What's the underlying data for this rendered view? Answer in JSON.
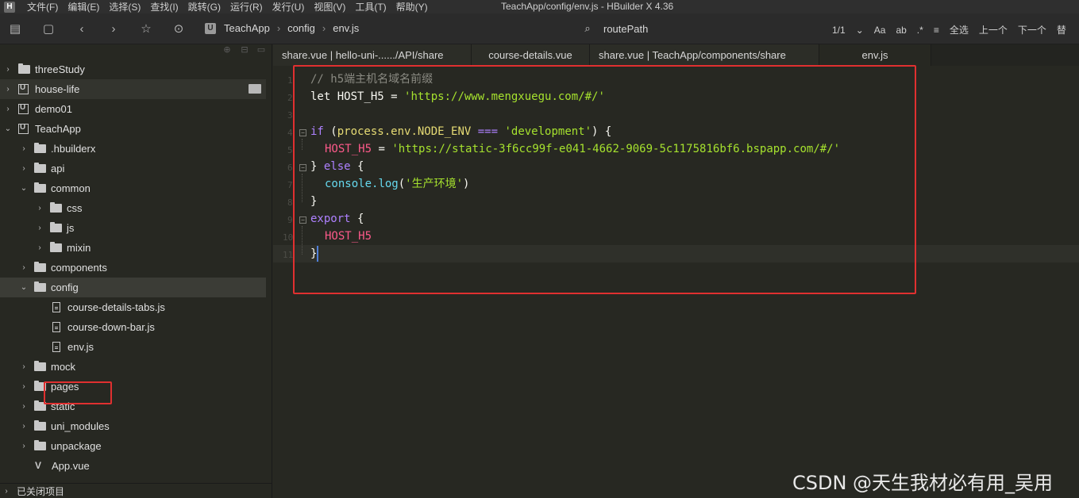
{
  "menubar": {
    "logo": "H",
    "items": [
      "文件(F)",
      "编辑(E)",
      "选择(S)",
      "查找(I)",
      "跳转(G)",
      "运行(R)",
      "发行(U)",
      "视图(V)",
      "工具(T)",
      "帮助(Y)"
    ],
    "title": "TeachApp/config/env.js - HBuilder X 4.36"
  },
  "toolbar": {
    "breadcrumb": [
      "TeachApp",
      "config",
      "env.js"
    ],
    "breadcrumb_badge": "U",
    "search_value": "routePath",
    "find_count": "1/1",
    "find_case": "Aa",
    "find_word": "ab",
    "find_regex": ".*",
    "find_buttons": [
      "全选",
      "上一个",
      "下一个",
      "替"
    ]
  },
  "sidebar": {
    "items": [
      {
        "label": "threeStudy",
        "type": "folder",
        "expanded": false
      },
      {
        "label": "house-life",
        "type": "project",
        "expanded": false
      },
      {
        "label": "demo01",
        "type": "project",
        "expanded": false
      },
      {
        "label": "TeachApp",
        "type": "project",
        "expanded": true
      },
      {
        "label": ".hbuilderx",
        "type": "folder",
        "expanded": false
      },
      {
        "label": "api",
        "type": "folder",
        "expanded": false
      },
      {
        "label": "common",
        "type": "folder",
        "expanded": true
      },
      {
        "label": "css",
        "type": "folder",
        "expanded": false
      },
      {
        "label": "js",
        "type": "folder",
        "expanded": false
      },
      {
        "label": "mixin",
        "type": "folder",
        "expanded": false
      },
      {
        "label": "components",
        "type": "folder",
        "expanded": false
      },
      {
        "label": "config",
        "type": "folder",
        "expanded": true
      },
      {
        "label": "course-details-tabs.js",
        "type": "file"
      },
      {
        "label": "course-down-bar.js",
        "type": "file"
      },
      {
        "label": "env.js",
        "type": "file"
      },
      {
        "label": "mock",
        "type": "folder",
        "expanded": false
      },
      {
        "label": "pages",
        "type": "folder",
        "expanded": false
      },
      {
        "label": "static",
        "type": "folder",
        "expanded": false
      },
      {
        "label": "uni_modules",
        "type": "folder",
        "expanded": false
      },
      {
        "label": "unpackage",
        "type": "folder",
        "expanded": false
      },
      {
        "label": "App.vue",
        "type": "vue"
      }
    ],
    "footer": "已关闭项目"
  },
  "tabs": [
    {
      "label": "share.vue | hello-uni-....../API/share"
    },
    {
      "label": "course-details.vue"
    },
    {
      "label": "share.vue | TeachApp/components/share"
    },
    {
      "label": "env.js",
      "active": true
    }
  ],
  "editor": {
    "line_numbers": [
      "1",
      "2",
      "3",
      "4",
      "5",
      "6",
      "7",
      "8",
      "9",
      "10",
      "11"
    ],
    "line1_comment": "// h5端主机名域名前缀",
    "line2_let": "let",
    "line2_var": " HOST_H5 = ",
    "line2_str": "'https://www.mengxuegu.com/#/'",
    "line4_if": "if",
    "line4_open": " (",
    "line4_process": "process",
    "line4_env": ".env.NODE_ENV",
    "line4_op": " === ",
    "line4_str": "'development'",
    "line4_close": ") {",
    "line5_var": "HOST_H5",
    "line5_eq": " = ",
    "line5_str": "'https://static-3f6cc99f-e041-4662-9069-5c1175816bf6.bspapp.com/#/'",
    "line6_close": "} ",
    "line6_else": "else",
    "line6_open": " {",
    "line7_console": "console",
    "line7_log": ".log",
    "line7_paren": "(",
    "line7_str": "'生产环境'",
    "line7_end": ")",
    "line8": "}",
    "line9_export": "export",
    "line9_open": " {",
    "line10": "HOST_H5",
    "line11": "}"
  },
  "watermark": "CSDN @天生我材必有用_吴用"
}
